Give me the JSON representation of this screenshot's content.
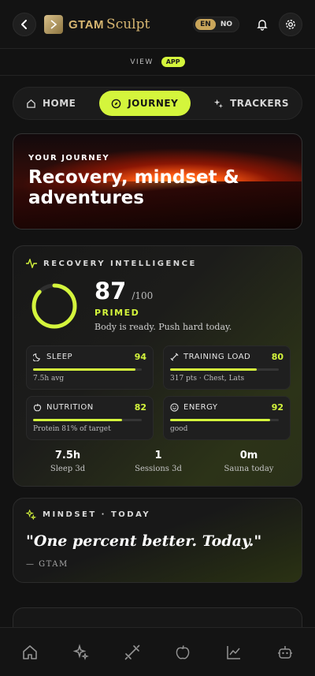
{
  "header": {
    "brand_bold": "GTAM",
    "brand_script": "Sculpt",
    "lang_active": "EN",
    "lang_other": "NO",
    "icons": [
      "back-icon",
      "bell-icon",
      "settings-icon"
    ]
  },
  "view": {
    "label": "VIEW",
    "mode": "APP"
  },
  "tabs": [
    {
      "label": "HOME",
      "icon": "home-icon"
    },
    {
      "label": "JOURNEY",
      "icon": "compass-icon"
    },
    {
      "label": "TRACKERS",
      "icon": "tracker-icon"
    }
  ],
  "hero": {
    "kicker": "YOUR JOURNEY",
    "title": "Recovery, mindset & adventures"
  },
  "recovery": {
    "title": "RECOVERY INTELLIGENCE",
    "score": "87",
    "score_max": "/100",
    "score_fraction": 0.87,
    "state": "PRIMED",
    "note": "Body is ready. Push hard today.",
    "metrics": [
      {
        "label": "SLEEP",
        "value": "94",
        "sub": "7.5h avg",
        "fill": 0.94,
        "icon": "moon-icon"
      },
      {
        "label": "TRAINING LOAD",
        "value": "80",
        "sub": "317 pts · Chest, Lats",
        "fill": 0.8,
        "icon": "dumbbell-icon"
      },
      {
        "label": "NUTRITION",
        "value": "82",
        "sub": "Protein 81% of target",
        "fill": 0.82,
        "icon": "apple-icon"
      },
      {
        "label": "ENERGY",
        "value": "92",
        "sub": "good",
        "fill": 0.92,
        "icon": "smile-icon"
      }
    ],
    "stats": [
      {
        "value": "7.5h",
        "label": "Sleep 3d"
      },
      {
        "value": "1",
        "label": "Sessions 3d"
      },
      {
        "value": "0m",
        "label": "Sauna today"
      }
    ]
  },
  "mindset": {
    "title": "MINDSET · TODAY",
    "quote": "\"One percent better. Today.\"",
    "author": "— GTAM"
  },
  "colors": {
    "accent": "#d4f53c",
    "gold": "#d8b772",
    "bg": "#121212"
  },
  "bottom_nav": [
    "home-icon",
    "sparkles-icon",
    "dumbbell-icon",
    "apple-icon",
    "chart-icon",
    "robot-icon"
  ]
}
